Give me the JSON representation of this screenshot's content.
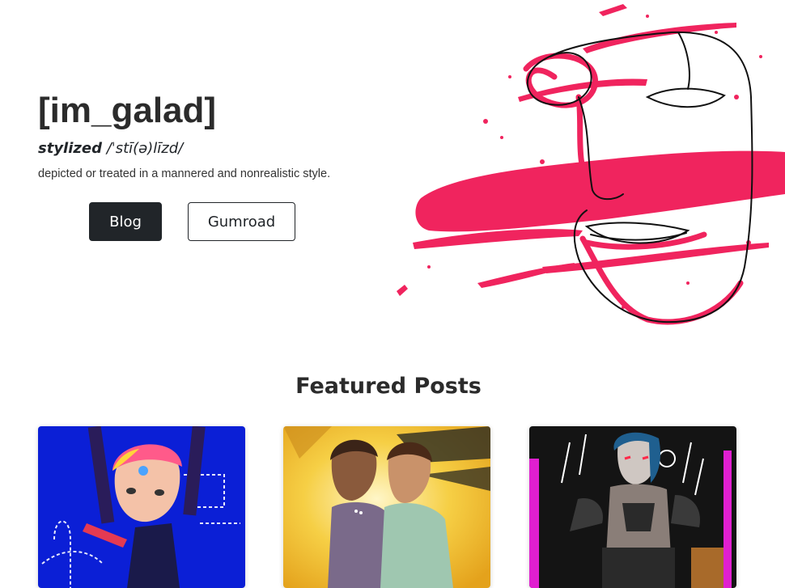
{
  "hero": {
    "title": "[im_galad]",
    "word": "stylized",
    "pronunciation": "/ˈstī(ə)līzd/",
    "meaning": "depicted or treated in a mannered and nonrealistic style."
  },
  "buttons": {
    "blog_label": "Blog",
    "gumroad_label": "Gumroad"
  },
  "featured": {
    "title": "Featured Posts"
  },
  "colors": {
    "accent": "#f0245e",
    "dark": "#212529",
    "card1_bg": "#0b1fd6",
    "card2_bg": "#f3c53a",
    "card3_bg": "#141414"
  }
}
